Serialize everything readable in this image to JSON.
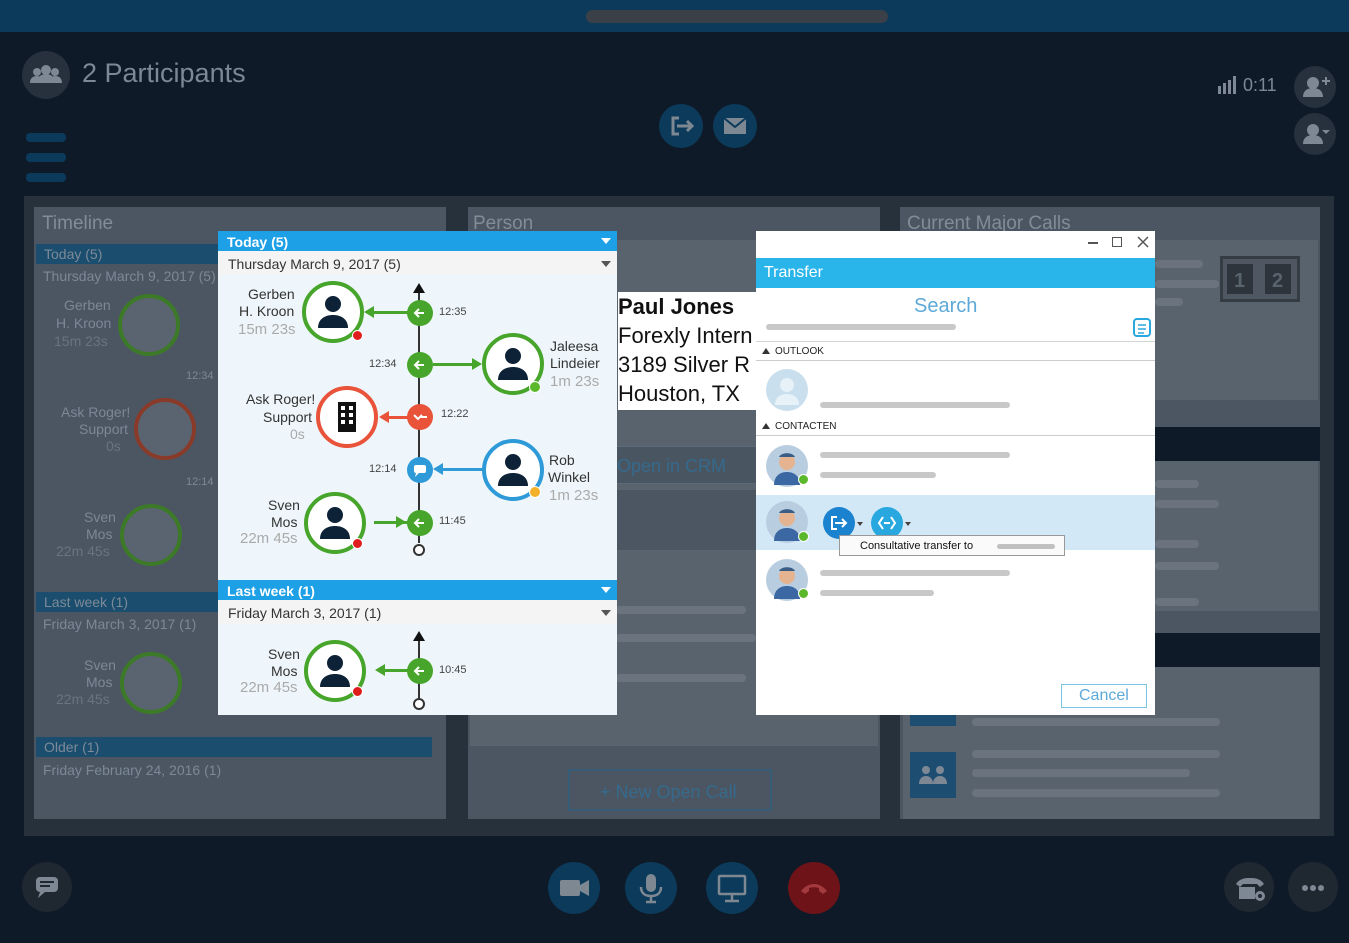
{
  "header": {
    "participants_label": "2 Participants",
    "signal_time": "0:11"
  },
  "bg_timeline": {
    "title": "Timeline",
    "today": "Today (5)",
    "date": "Thursday March 9, 2017 (5)",
    "entries": [
      {
        "name1": "Gerben",
        "name2": "H. Kroon",
        "dur": "15m 23s"
      },
      {
        "name1": "Ask Roger!",
        "name2": "Support",
        "dur": "0s"
      },
      {
        "name1": "Sven",
        "name2": "Mos",
        "dur": "22m 45s"
      }
    ],
    "times": [
      "12:34",
      "12:14"
    ],
    "last_week": "Last week (1)",
    "last_week_date": "Friday March 3, 2017 (1)",
    "last_week_entry": {
      "name1": "Sven",
      "name2": "Mos",
      "dur": "22m 45s"
    },
    "older": "Older (1)",
    "older_date": "Friday February 24, 2016 (1)"
  },
  "bg_person": {
    "title": "Person",
    "open_crm": "Open in CRM",
    "new_call": "+ New Open Call"
  },
  "bg_calls": {
    "title": "Current Major Calls"
  },
  "person": {
    "name": "Paul Jones",
    "line1": "Forexly Intern",
    "line2": "3189 Silver R",
    "line3": "Houston, TX"
  },
  "timeline": {
    "today_header": "Today (5)",
    "today_date": "Thursday March 9, 2017 (5)",
    "events": [
      {
        "name1": "Gerben",
        "name2": "H. Kroon",
        "dur": "15m 23s",
        "time": "12:35"
      },
      {
        "name1": "Jaleesa",
        "name2": "Lindeier",
        "dur": "1m 23s",
        "time": "12:34"
      },
      {
        "name1": "Ask Roger!",
        "name2": "Support",
        "dur": "0s",
        "time": "12:22"
      },
      {
        "name1": "Rob",
        "name2": "Winkel",
        "dur": "1m 23s",
        "time": "12:14"
      },
      {
        "name1": "Sven",
        "name2": "Mos",
        "dur": "22m 45s",
        "time": "11:45"
      }
    ],
    "lastweek_header": "Last week (1)",
    "lastweek_date": "Friday March 3, 2017 (1)",
    "lastweek_event": {
      "name1": "Sven",
      "name2": "Mos",
      "dur": "22m 45s",
      "time": "10:45"
    }
  },
  "transfer": {
    "title": "Transfer",
    "search_placeholder": "Search",
    "section_outlook": "OUTLOOK",
    "section_contacts": "CONTACTEN",
    "tooltip": "Consultative transfer to",
    "cancel": "Cancel"
  },
  "colors": {
    "accent": "#1ea0e6",
    "green": "#46a52a",
    "red": "#e8533a",
    "blue": "#2e9ad8",
    "end_call": "#c62828"
  }
}
